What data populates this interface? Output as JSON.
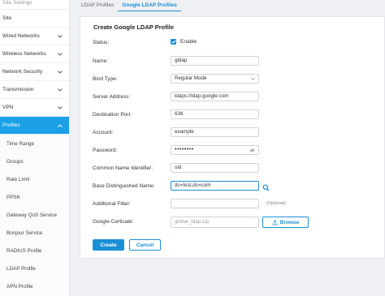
{
  "sidebar": {
    "top_label": "Site Settings",
    "items": [
      {
        "label": "Site",
        "has_chevron": false
      },
      {
        "label": "Wired Networks",
        "has_chevron": true
      },
      {
        "label": "Wireless Networks",
        "has_chevron": true
      },
      {
        "label": "Network Security",
        "has_chevron": true
      },
      {
        "label": "Transmission",
        "has_chevron": true
      },
      {
        "label": "VPN",
        "has_chevron": true
      },
      {
        "label": "Profiles",
        "has_chevron": true,
        "expanded": true
      }
    ],
    "sub_items": [
      "Time Range",
      "Groups",
      "Rate Limit",
      "PPSK",
      "Gateway QoS Service",
      "Bonjour Service",
      "RADIUS Profile",
      "LDAP Profile",
      "APN Profile"
    ]
  },
  "tabs": [
    {
      "label": "LDAP Profiles",
      "active": false
    },
    {
      "label": "Google LDAP Profiles",
      "active": true
    }
  ],
  "form": {
    "title": "Create Google LDAP Profile",
    "status_label": "Status:",
    "enable_label": "Enable",
    "enable_checked": true,
    "name_label": "Name:",
    "name_value": "gldap",
    "bind_type_label": "Bind Type:",
    "bind_type_value": "Regular Mode",
    "server_address_label": "Server Address:",
    "server_address_value": "ldaps://ldap.google.com",
    "destination_port_label": "Destination Port:",
    "destination_port_value": "636",
    "account_label": "Account:",
    "account_value": "example",
    "password_label": "Password:",
    "password_value": "••••••••",
    "common_name_label": "Common Name Identifier:",
    "common_name_value": "uid",
    "base_dn_label": "Base Distinguished Name:",
    "base_dn_value": "dc=test,dc=com",
    "additional_filter_label": "Additional Filter:",
    "additional_filter_value": "",
    "optional_text": "(Optional)",
    "cert_label": "Google Certicate:",
    "cert_placeholder": "global_ldap.zip",
    "browse_label": "Browse",
    "create_label": "Create",
    "cancel_label": "Cancel"
  },
  "colors": {
    "accent": "#1a8fd6",
    "sidebar_active": "#1ba0e6"
  }
}
